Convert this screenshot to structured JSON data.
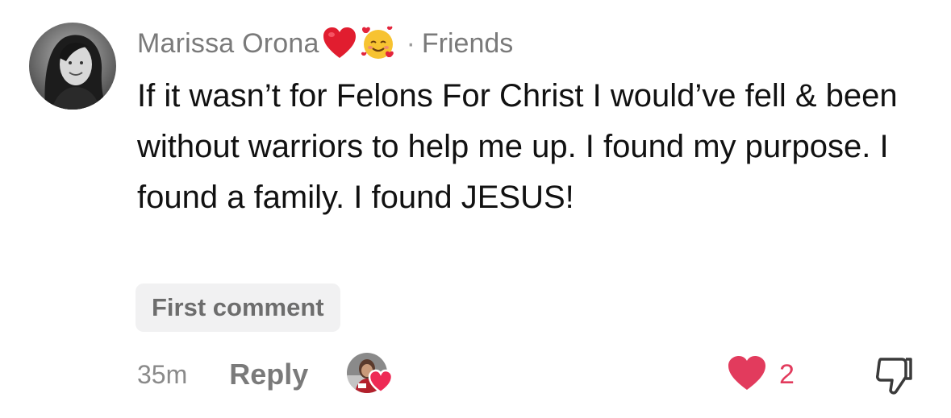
{
  "comment": {
    "author": "Marissa Orona",
    "author_emojis": [
      "red-heart-emoji",
      "smiling-face-with-hearts-emoji"
    ],
    "separator": "·",
    "relation": "Friends",
    "text": "If it wasn’t for Felons For Christ I would’ve fell & been without warriors to help me up. I found my purpose. I found a family. I found JESUS!",
    "badge": "First comment",
    "timestamp": "35m",
    "reply_label": "Reply",
    "like_count": "2",
    "creator_liked_icon": "creator-liked-heart-icon"
  },
  "colors": {
    "like_red": "#e23b5d",
    "muted_text": "#7a7a7a",
    "badge_bg": "#f1f1f2"
  }
}
